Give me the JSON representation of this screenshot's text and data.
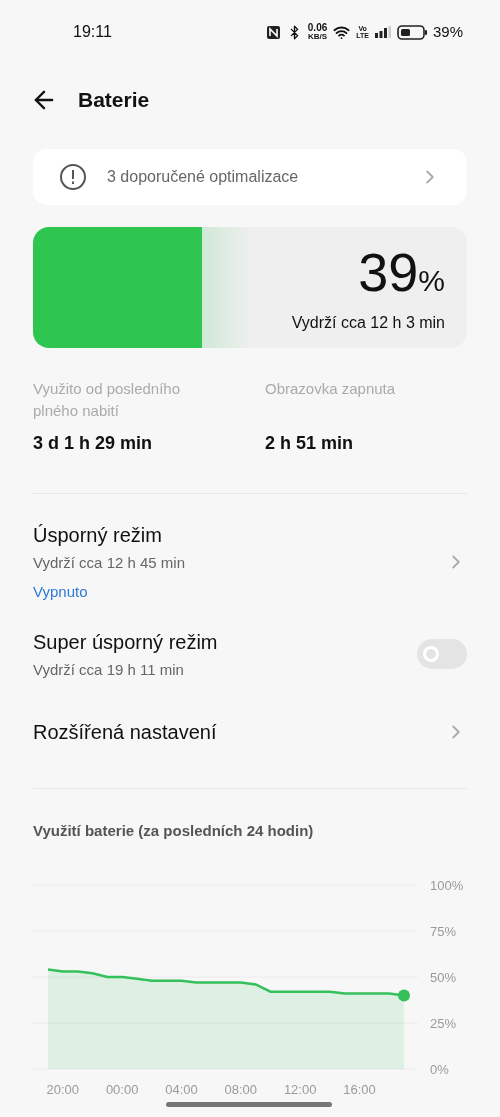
{
  "status_bar": {
    "time": "19:11",
    "data_rate": "0.06",
    "data_unit": "KB/S",
    "volte_top": "Vo",
    "volte_bottom": "LTE",
    "battery": "39%"
  },
  "header": {
    "title": "Baterie"
  },
  "recommendation": {
    "text": "3 doporučené optimalizace"
  },
  "battery": {
    "level": 0.39,
    "percent": "39",
    "percent_sign": "%",
    "estimate": "Vydrží cca 12 h 3 min"
  },
  "stats": [
    {
      "label": "Využito od posledního plného nabití",
      "value": "3 d 1 h 29 min"
    },
    {
      "label": "Obrazovka zapnuta",
      "value": "2 h 51 min"
    }
  ],
  "settings": [
    {
      "kind": "nav",
      "title": "Úsporný režim",
      "subtitle": "Vydrží cca 12 h 45 min",
      "status": "Vypnuto"
    },
    {
      "kind": "toggle",
      "title": "Super úsporný režim",
      "subtitle": "Vydrží cca 19 h 11 min",
      "on": false
    },
    {
      "kind": "nav",
      "title": "Rozšířená nastavení"
    }
  ],
  "usage": {
    "title": "Využití baterie (za posledních 24 hodin)",
    "chart_data": {
      "type": "area",
      "categories": [
        null,
        "20:00",
        null,
        null,
        null,
        "00:00",
        null,
        null,
        null,
        "04:00",
        null,
        null,
        null,
        "08:00",
        null,
        null,
        null,
        "12:00",
        null,
        null,
        null,
        "16:00",
        null,
        null,
        null
      ],
      "series": [
        {
          "color": "#34c05a",
          "values": [
            54,
            53,
            53,
            52,
            50,
            50,
            49,
            48,
            48,
            48,
            47,
            47,
            47,
            47,
            46,
            42,
            42,
            42,
            42,
            42,
            41,
            41,
            41,
            41,
            40
          ]
        }
      ],
      "ylim": [
        0,
        100
      ],
      "grid": true,
      "yticks": [
        {
          "value": 100,
          "label": "100%"
        },
        {
          "value": 75,
          "label": "75%"
        },
        {
          "value": 50,
          "label": "50%"
        },
        {
          "value": 25,
          "label": "25%"
        },
        {
          "value": 0,
          "label": "0%"
        }
      ]
    }
  }
}
